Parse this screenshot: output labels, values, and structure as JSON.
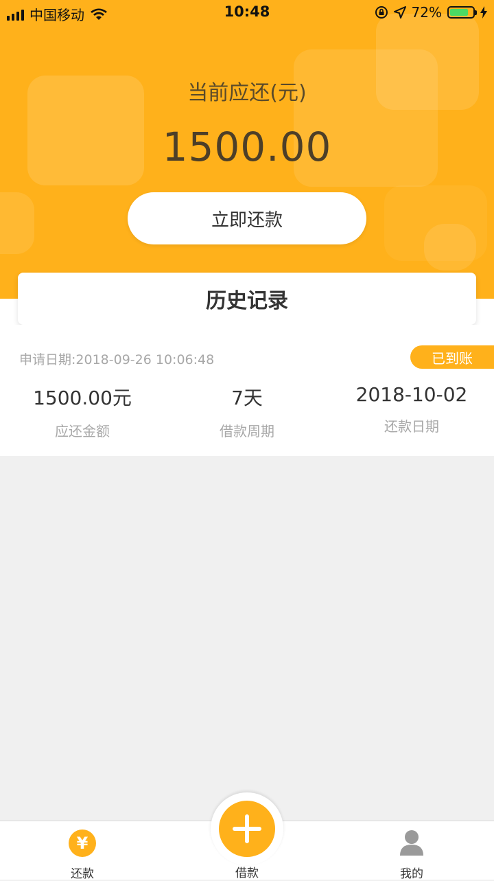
{
  "status_bar": {
    "carrier": "中国移动",
    "time": "10:48",
    "battery_text": "72%",
    "icons": [
      "signal-icon",
      "wifi-icon",
      "orientation-lock-icon",
      "location-arrow-icon",
      "battery-icon",
      "charging-bolt-icon"
    ]
  },
  "header": {
    "label": "当前应还(元)",
    "amount": "1500.00",
    "repay_button": "立即还款",
    "accent_color": "#ffb11b"
  },
  "history": {
    "title": "历史记录",
    "record": {
      "apply_date": "申请日期:2018-09-26 10:06:48",
      "status": "已到账",
      "stats": [
        {
          "value": "1500.00元",
          "label": "应还金额"
        },
        {
          "value": "7天",
          "label": "借款周期"
        },
        {
          "value": "2018-10-02",
          "label": "还款日期"
        }
      ]
    }
  },
  "tabbar": {
    "tabs": [
      {
        "label": "还款",
        "icon": "yen-icon"
      },
      {
        "label": "借款",
        "icon": "plus-icon"
      },
      {
        "label": "我的",
        "icon": "user-icon"
      }
    ]
  }
}
